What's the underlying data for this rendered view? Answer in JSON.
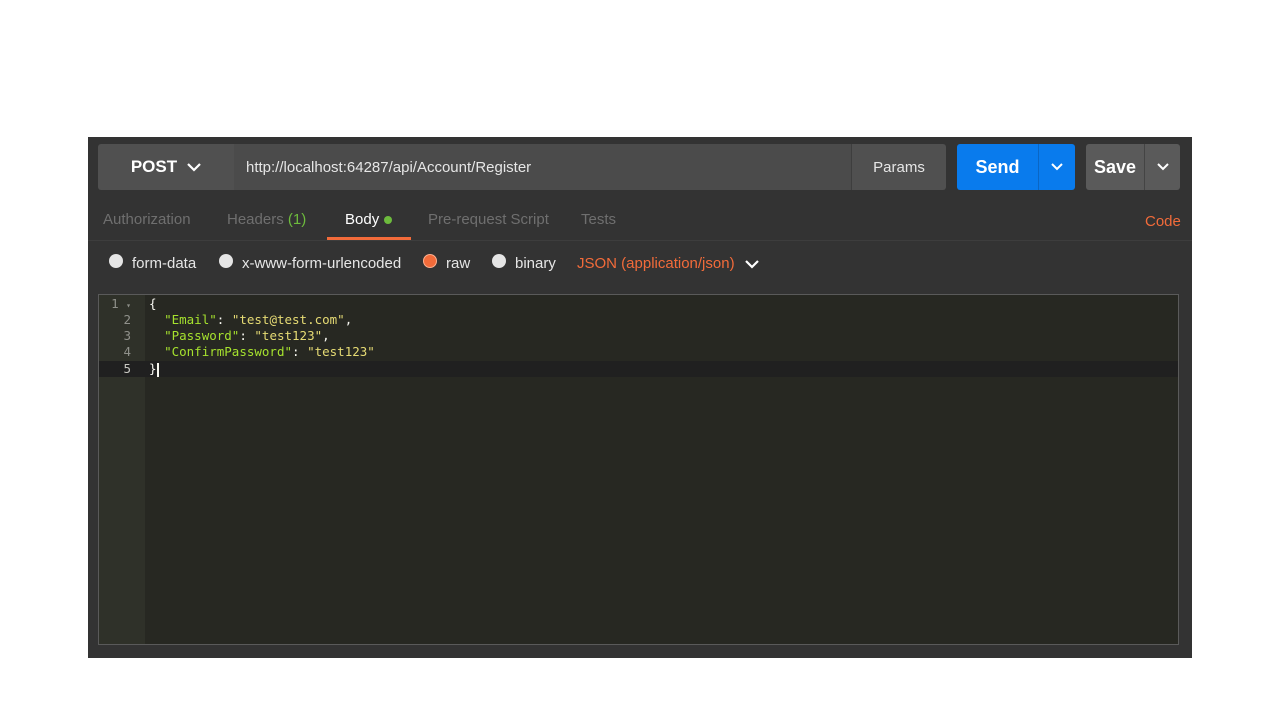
{
  "request": {
    "method": "POST",
    "url": "http://localhost:64287/api/Account/Register",
    "params_label": "Params",
    "send_label": "Send",
    "save_label": "Save"
  },
  "tabs": [
    {
      "label": "Authorization"
    },
    {
      "label": "Headers",
      "count": "(1)"
    },
    {
      "label": "Body"
    },
    {
      "label": "Pre-request Script"
    },
    {
      "label": "Tests"
    }
  ],
  "code_link": "Code",
  "body_types": [
    {
      "label": "form-data"
    },
    {
      "label": "x-www-form-urlencoded"
    },
    {
      "label": "raw",
      "selected": true
    },
    {
      "label": "binary"
    }
  ],
  "content_type": "JSON (application/json)",
  "editor": {
    "line_numbers": [
      "1",
      "2",
      "3",
      "4",
      "5"
    ],
    "lines": [
      {
        "open": "{"
      },
      {
        "indent": "  ",
        "key": "\"Email\"",
        "sep": ": ",
        "value": "\"test@test.com\"",
        "trail": ","
      },
      {
        "indent": "  ",
        "key": "\"Password\"",
        "sep": ": ",
        "value": "\"test123\"",
        "trail": ","
      },
      {
        "indent": "  ",
        "key": "\"ConfirmPassword\"",
        "sep": ": ",
        "value": "\"test123\"",
        "trail": ""
      },
      {
        "close": "}"
      }
    ]
  },
  "colors": {
    "accent_orange": "#f26b3a",
    "send_blue": "#097bed",
    "status_green": "#6dbb3d",
    "json_key": "#a6e22e",
    "json_string": "#e6db74"
  }
}
